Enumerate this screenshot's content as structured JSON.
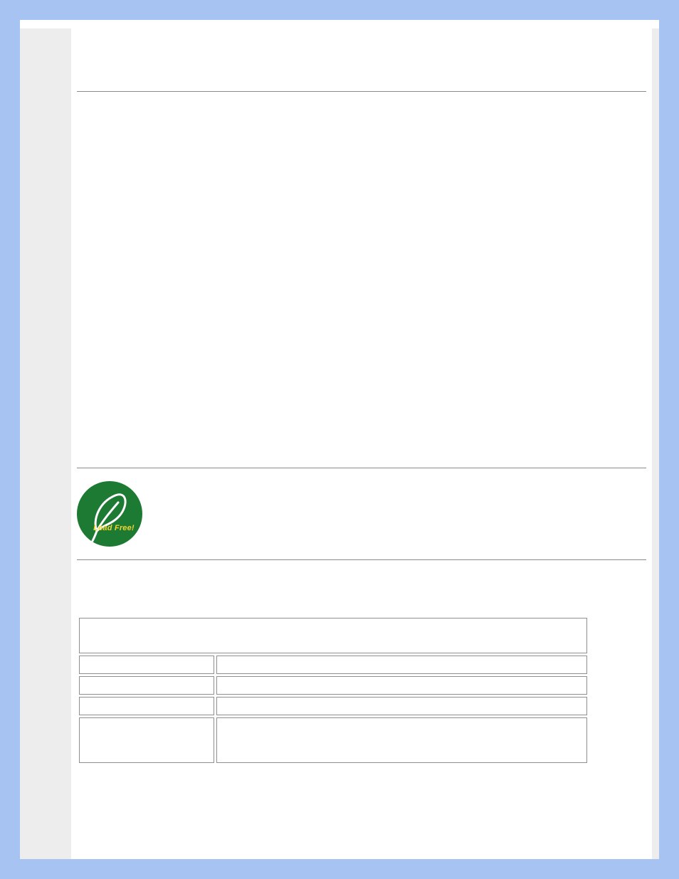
{
  "badge": {
    "label": "Lead Free!"
  },
  "table": {
    "header": "",
    "rows": [
      {
        "key": "",
        "value": ""
      },
      {
        "key": "",
        "value": ""
      },
      {
        "key": "",
        "value": ""
      },
      {
        "key": "",
        "value": ""
      }
    ]
  }
}
